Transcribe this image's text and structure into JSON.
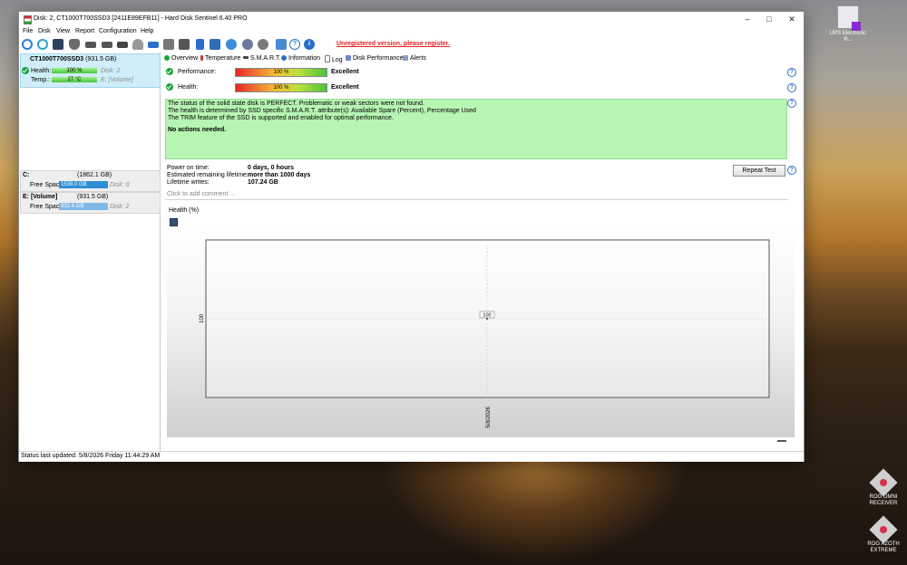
{
  "window": {
    "title": "Disk: 2, CT1000T700SSD3 [2411E89EFB11]  -  Hard Disk Sentinel 6.40 PRO",
    "controls": [
      "minimize",
      "maximize",
      "close"
    ]
  },
  "menu": [
    "File",
    "Disk",
    "View",
    "Report",
    "Configuration",
    "Help"
  ],
  "toolbar": {
    "icons": [
      "refresh-icon",
      "refresh-all-icon",
      "disk-info-icon",
      "disk-icon",
      "disk-tool-icon",
      "disk-test-icon",
      "disk-search-icon",
      "disk-gray-icon",
      "disk-eject-icon",
      "disk-settings-icon",
      "disk-export-icon",
      "report-icon",
      "email-icon",
      "network-icon",
      "options-icon",
      "options-alt-icon",
      "camera-icon",
      "help-icon",
      "info-icon"
    ],
    "register_text": "Unregistered version, please register."
  },
  "left": {
    "disk_name": "CT1000T700SSD3",
    "disk_size": "(931.5 GB)",
    "health_label": "Health:",
    "health_value": "100 %",
    "health_disk": "Disk: 2",
    "temp_label": "Temp.:",
    "temp_value": "27 °C",
    "temp_volume": "E: [Volume]",
    "volumes": [
      {
        "name": "C:",
        "size": "(1862.1 GB)",
        "free_label": "Free Space",
        "free": "1538.0 GB",
        "disk": "Disk: 0"
      },
      {
        "name": "E: [Volume]",
        "size": "(931.5 GB)",
        "free_label": "Free Space",
        "free": "931.4 GB",
        "disk": "Disk: 2"
      }
    ]
  },
  "tabs": [
    "Overview",
    "Temperature",
    "S.M.A.R.T.",
    "Information",
    "Log",
    "Disk Performance",
    "Alerts"
  ],
  "overview": {
    "performance_label": "Performance:",
    "performance_bar": "100 %",
    "performance_value": "Excellent",
    "performance_level": 100,
    "health_label": "Health:",
    "health_bar": "100 %",
    "health_value": "Excellent",
    "health_level": 100,
    "status_lines": [
      "The status of the solid state disk is PERFECT. Problematic or weak sectors were not found.",
      "The health is determined by SSD specific S.M.A.R.T. attribute(s):  Available Spare (Percent), Percentage Used",
      "The TRIM feature of the SSD is supported and enabled for optimal performance."
    ],
    "status_action": "No actions needed.",
    "power_on_label": "Power on time:",
    "power_on_value": "0 days, 0 hours",
    "lifetime_label": "Estimated remaining lifetime:",
    "lifetime_value": "more than 1000 days",
    "writes_label": "Lifetime writes:",
    "writes_value": "107.24 GB",
    "repeat_button": "Repeat Test",
    "comment_placeholder": "Click to add comment ..."
  },
  "chart_data": {
    "type": "line",
    "title": "Health (%)",
    "x": [
      "5/8/2026"
    ],
    "series": [
      {
        "values": [
          100
        ]
      }
    ],
    "ylabel": "",
    "y_tick": "100",
    "point_label": "100",
    "grid": true
  },
  "status_bar": "Status last updated: 5/8/2026 Friday 11:44:29 AM",
  "desktop_icons": [
    {
      "label": "UPS Electronic R...",
      "color": "#c9c9d9"
    },
    {
      "label": "ROG OMNI RECEIVER",
      "color": "#d0d0d0"
    },
    {
      "label": "ROG AZOTH EXTREME",
      "color": "#d0d0d0"
    }
  ]
}
